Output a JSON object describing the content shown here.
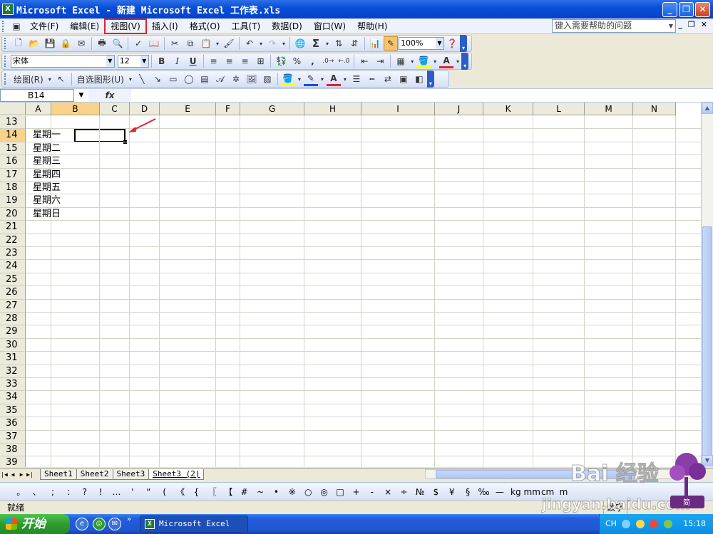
{
  "window": {
    "title": "Microsoft Excel - 新建 Microsoft Excel 工作表.xls",
    "app_icon": "X"
  },
  "menu": {
    "items": [
      "文件(F)",
      "编辑(E)",
      "视图(V)",
      "插入(I)",
      "格式(O)",
      "工具(T)",
      "数据(D)",
      "窗口(W)",
      "帮助(H)"
    ],
    "highlighted": "视图(V)",
    "help_placeholder": "键入需要帮助的问题"
  },
  "standard_toolbar": {
    "zoom": "100%"
  },
  "format_toolbar": {
    "font": "宋体",
    "size": "12",
    "bold": "B",
    "italic": "I",
    "underline": "U",
    "percent": "%",
    "comma": ","
  },
  "drawing_toolbar": {
    "draw_label": "绘图(R)",
    "autoshape_label": "自选图形(U)"
  },
  "formula_bar": {
    "name_box": "B14",
    "fx": "fx",
    "value": ""
  },
  "sheet": {
    "columns": [
      "A",
      "B",
      "C",
      "D",
      "E",
      "F",
      "G",
      "H",
      "I",
      "J",
      "K",
      "L",
      "M",
      "N"
    ],
    "rows": [
      "13",
      "14",
      "15",
      "16",
      "17",
      "18",
      "19",
      "20",
      "21",
      "22",
      "23",
      "24",
      "25",
      "26",
      "27",
      "28",
      "29",
      "30",
      "31",
      "32",
      "33",
      "34",
      "35",
      "36",
      "37",
      "38",
      "39"
    ],
    "selected_column": "B",
    "selected_row": "14",
    "active_cell": "B14",
    "a_column_values": [
      "",
      "星期一",
      "星期二",
      "星期三",
      "星期四",
      "星期五",
      "星期六",
      "星期日"
    ]
  },
  "sheet_tabs": [
    "Sheet1",
    "Sheet2",
    "Sheet3",
    "Sheet3 (2)"
  ],
  "active_tab": "Sheet3 (2)",
  "symbols": [
    "。",
    "、",
    ";",
    ":",
    "?",
    "!",
    "…",
    "'",
    "“",
    "(",
    "《",
    "{",
    "〖",
    "【",
    "#",
    "~",
    "•",
    "※",
    "○",
    "◎",
    "□",
    "+",
    "-",
    "×",
    "÷",
    "№",
    "$",
    "¥",
    "§",
    "‰",
    "—",
    "kg",
    "mm",
    "cm",
    "m"
  ],
  "status": {
    "ready": "就绪",
    "mode": "数字"
  },
  "taskbar": {
    "start": "开始",
    "window": "Microsoft Excel ...",
    "lang": "CH",
    "clock": "15:18"
  },
  "watermark": {
    "brand": "Bai 经验",
    "url": "jingyan.baidu.com",
    "badge": "简"
  }
}
